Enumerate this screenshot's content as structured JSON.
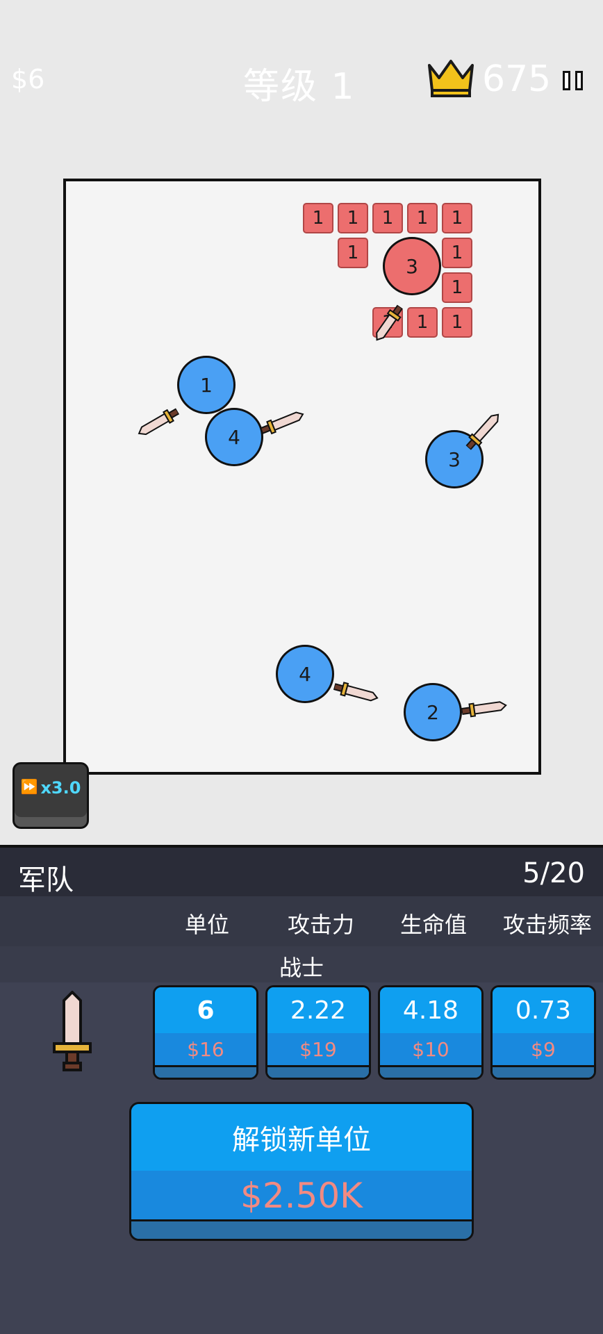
{
  "hud": {
    "money": "$6",
    "level": "等级 1",
    "crown_count": "675",
    "crown_icon": "crown-icon",
    "pause_icon": "pause-icon"
  },
  "arena": {
    "enemy_bricks": [
      "1",
      "1",
      "1",
      "1",
      "1",
      "1",
      "1",
      "1",
      "1",
      "1",
      "1",
      "1"
    ],
    "enemy_ball": "3",
    "player_balls": [
      "1",
      "4",
      "3",
      "4",
      "2"
    ]
  },
  "speed_button": {
    "icon": "fast-forward-icon",
    "label": "x3.0"
  },
  "army": {
    "title": "军队",
    "count": "5/20",
    "headers": [
      "单位",
      "攻击力",
      "生命值",
      "攻击频率"
    ],
    "unit_name": "战士",
    "unit_icon": "sword-icon",
    "stats": [
      {
        "value": "6",
        "cost": "$16"
      },
      {
        "value": "2.22",
        "cost": "$19"
      },
      {
        "value": "4.18",
        "cost": "$10"
      },
      {
        "value": "0.73",
        "cost": "$9"
      }
    ],
    "unlock": {
      "label": "解锁新单位",
      "cost": "$2.50K"
    }
  },
  "colors": {
    "player_ball": "#4aa0f4",
    "enemy": "#ec6e6e",
    "button_top": "#0f9ff0",
    "cost_text": "#f28a82",
    "panel_bg": "#3f4253",
    "speed_text": "#4fd8ff"
  }
}
